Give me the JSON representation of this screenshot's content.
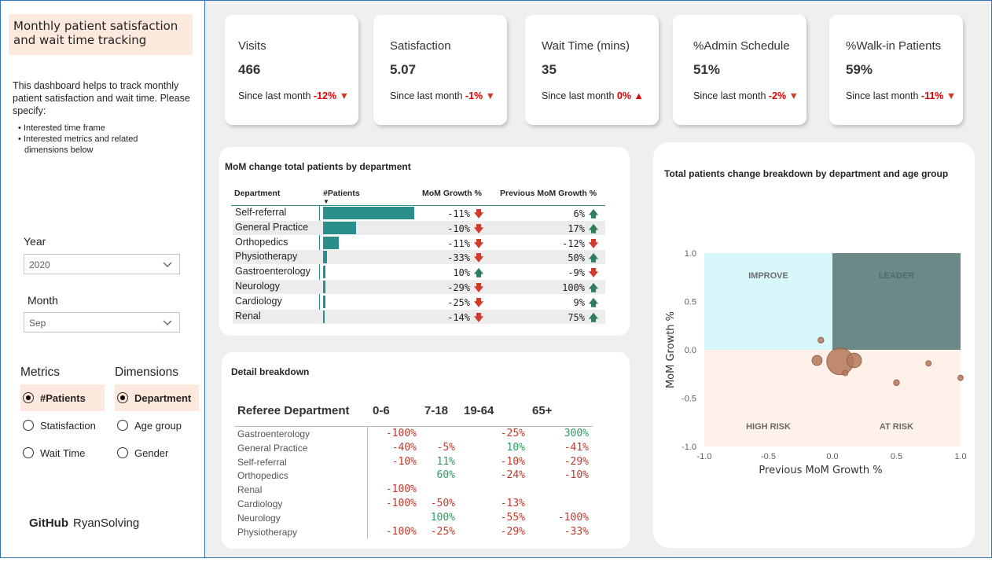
{
  "sidebar": {
    "title": "Monthly patient satisfaction and wait time tracking",
    "description": "This dashboard helps to track monthly patient satisfaction and wait time. Please specify:",
    "bullets": [
      "• Interested time frame",
      "• Interested metrics and related",
      "dimensions below"
    ],
    "year_label": "Year",
    "year_value": "2020",
    "month_label": "Month",
    "month_value": "Sep",
    "metrics_label": "Metrics",
    "dimensions_label": "Dimensions",
    "metrics": [
      "#Patients",
      "Statisfaction",
      "Wait Time"
    ],
    "dimensions": [
      "Department",
      "Age group",
      "Gender"
    ],
    "github_brand": "GitHub",
    "github_user": "RyanSolving"
  },
  "kpis": [
    {
      "title": "Visits",
      "value": "466",
      "since": "Since last month",
      "change": "-12%",
      "dir": "down"
    },
    {
      "title": "Satisfaction",
      "value": "5.07",
      "since": "Since last month",
      "change": "-1%",
      "dir": "down"
    },
    {
      "title": "Wait Time (mins)",
      "value": "35",
      "since": "Since last month",
      "change": "0%",
      "dir": "up"
    },
    {
      "title": "%Admin Schedule",
      "value": "51%",
      "since": "Since last month",
      "change": "-2%",
      "dir": "down"
    },
    {
      "title": "%Walk-in Patients",
      "value": "59%",
      "since": "Since last month",
      "change": "-11%",
      "dir": "down"
    }
  ],
  "mom": {
    "title": "MoM change total patients by department",
    "headers": [
      "Department",
      "#Patients",
      "MoM Growth %",
      "Previous MoM Growth %"
    ],
    "rows": [
      {
        "dept": "Self-referral",
        "bar": 1.0,
        "g": "-11%",
        "gdir": "down",
        "p": "6%",
        "pdir": "up"
      },
      {
        "dept": "General Practice",
        "bar": 0.36,
        "g": "-10%",
        "gdir": "down",
        "p": "17%",
        "pdir": "up"
      },
      {
        "dept": "Orthopedics",
        "bar": 0.17,
        "g": "-11%",
        "gdir": "down",
        "p": "-12%",
        "pdir": "down"
      },
      {
        "dept": "Physiotherapy",
        "bar": 0.04,
        "g": "-33%",
        "gdir": "down",
        "p": "50%",
        "pdir": "up"
      },
      {
        "dept": "Gastroenterology",
        "bar": 0.03,
        "g": "10%",
        "gdir": "up",
        "p": "-9%",
        "pdir": "down"
      },
      {
        "dept": "Neurology",
        "bar": 0.03,
        "g": "-29%",
        "gdir": "down",
        "p": "100%",
        "pdir": "up"
      },
      {
        "dept": "Cardiology",
        "bar": 0.03,
        "g": "-25%",
        "gdir": "down",
        "p": "9%",
        "pdir": "up"
      },
      {
        "dept": "Renal",
        "bar": 0.02,
        "g": "-14%",
        "gdir": "down",
        "p": "75%",
        "pdir": "up"
      }
    ]
  },
  "detail": {
    "title": "Detail breakdown",
    "headers": [
      "Referee Department",
      "0-6",
      "7-18",
      "19-64",
      "65+"
    ],
    "rows": [
      {
        "dept": "Gastroenterology",
        "v": [
          "-100%",
          "",
          "-25%",
          "300%"
        ]
      },
      {
        "dept": "General Practice",
        "v": [
          "-40%",
          "-5%",
          "10%",
          "-41%"
        ]
      },
      {
        "dept": "Self-referral",
        "v": [
          "-10%",
          "11%",
          "-10%",
          "-29%"
        ]
      },
      {
        "dept": "Orthopedics",
        "v": [
          "",
          "60%",
          "-24%",
          "-10%"
        ]
      },
      {
        "dept": "Renal",
        "v": [
          "-100%",
          "",
          "",
          ""
        ]
      },
      {
        "dept": "Cardiology",
        "v": [
          "-100%",
          "-50%",
          "-13%",
          ""
        ]
      },
      {
        "dept": "Neurology",
        "v": [
          "",
          "100%",
          "-55%",
          "-100%"
        ]
      },
      {
        "dept": "Physiotherapy",
        "v": [
          "-100%",
          "-25%",
          "-29%",
          "-33%"
        ]
      }
    ]
  },
  "chart_data": {
    "type": "scatter",
    "title": "Total patients change breakdown by department and age group",
    "xlabel": "Previous MoM Growth %",
    "ylabel": "MoM Growth %",
    "xlim": [
      -1.0,
      1.0
    ],
    "ylim": [
      -1.0,
      1.0
    ],
    "xticks": [
      "-1.0",
      "-0.5",
      "0.0",
      "0.5",
      "1.0"
    ],
    "yticks": [
      "1.0",
      "0.5",
      "0.0",
      "-0.5",
      "-1.0"
    ],
    "quadrants": [
      "IMPROVE",
      "LEADER",
      "HIGH RISK",
      "AT RISK"
    ],
    "quadrant_colors": {
      "IMPROVE": "#d8f7fa",
      "LEADER": "#6b8a87",
      "HIGH RISK": "#fdf1ea",
      "AT RISK": "#fdf1ea"
    },
    "bubble_color": "#b5785a",
    "points": [
      {
        "x": 0.06,
        "y": -0.12,
        "r": 1.0
      },
      {
        "x": 0.17,
        "y": -0.11,
        "r": 0.55
      },
      {
        "x": -0.12,
        "y": -0.11,
        "r": 0.38
      },
      {
        "x": -0.09,
        "y": 0.1,
        "r": 0.22
      },
      {
        "x": 0.1,
        "y": -0.24,
        "r": 0.2
      },
      {
        "x": 0.75,
        "y": -0.14,
        "r": 0.18
      },
      {
        "x": 0.5,
        "y": -0.34,
        "r": 0.22
      },
      {
        "x": 1.0,
        "y": -0.29,
        "r": 0.2
      }
    ]
  }
}
